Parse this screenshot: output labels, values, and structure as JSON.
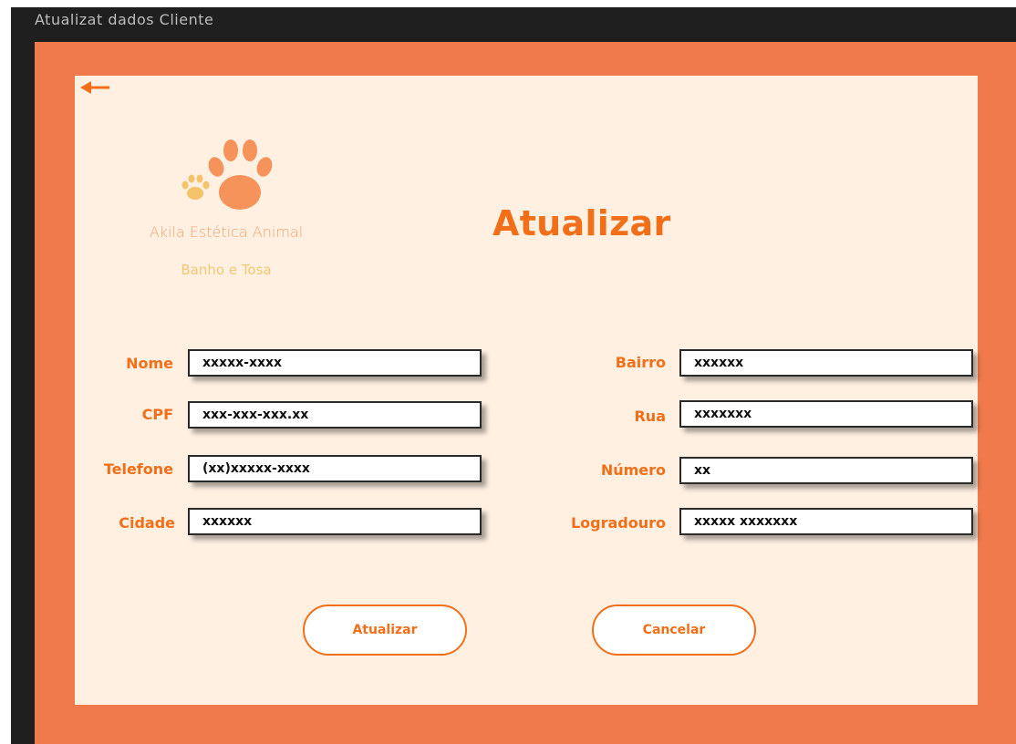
{
  "window": {
    "title": "Atualizat dados Cliente"
  },
  "brand": {
    "name": "Akila Estética  Animal",
    "tagline": "Banho e Tosa"
  },
  "page": {
    "title": "Atualizar"
  },
  "form": {
    "left": [
      {
        "label": "Nome",
        "value": "xxxxx-xxxx"
      },
      {
        "label": "CPF",
        "value": "xxx-xxx-xxx.xx"
      },
      {
        "label": "Telefone",
        "value": "(xx)xxxxx-xxxx"
      },
      {
        "label": "Cidade",
        "value": "xxxxxx"
      }
    ],
    "right": [
      {
        "label": "Bairro",
        "value": "xxxxxx"
      },
      {
        "label": "Rua",
        "value": "xxxxxxx"
      },
      {
        "label": "Número",
        "value": "xx"
      },
      {
        "label": "Logradouro",
        "value": "xxxxx xxxxxxx"
      }
    ]
  },
  "buttons": {
    "update_label": "Atualizar",
    "cancel_label": "Cancelar"
  },
  "icons": {
    "back": "back-arrow-icon",
    "logo": "paw-print-icon"
  },
  "colors": {
    "accent": "#f26f1a",
    "frame": "#f07a4b",
    "panel": "#fff0e2",
    "window_bg": "#1f1f1f",
    "paw_large": "#f5935a",
    "paw_small": "#f4c36a"
  }
}
